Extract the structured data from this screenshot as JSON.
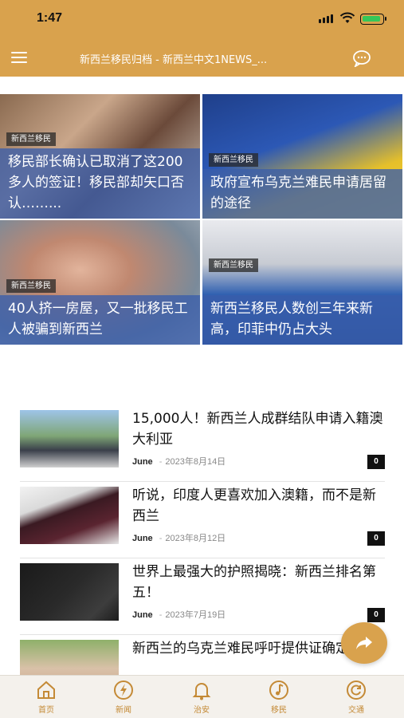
{
  "status_bar": {
    "time": "1:47"
  },
  "header": {
    "title": "新西兰移民归档 - 新西兰中文1NEWS_..."
  },
  "featured": [
    {
      "tag": "新西兰移民",
      "caption": "移民部长确认已取消了这200多人的签证！移民部却矢口否认……..."
    },
    {
      "tag": "新西兰移民",
      "caption": "政府宣布乌克兰难民申请居留的途径"
    },
    {
      "tag": "新西兰移民",
      "caption": "40人挤一房屋，又一批移民工人被骗到新西兰"
    },
    {
      "tag": "新西兰移民",
      "caption": "新西兰移民人数创三年来新高，印菲中仍占大头"
    }
  ],
  "articles": [
    {
      "title": "15,000人！新西兰人成群结队申请入籍澳大利亚",
      "author": "June",
      "date": "2023年8月14日",
      "comments": "0"
    },
    {
      "title": "听说，印度人更喜欢加入澳籍，而不是新西兰",
      "author": "June",
      "date": "2023年8月12日",
      "comments": "0"
    },
    {
      "title": "世界上最强大的护照揭晓：新西兰排名第五！",
      "author": "June",
      "date": "2023年7月19日",
      "comments": "0"
    },
    {
      "title": "新西兰的乌克兰难民呼吁提供证确定性",
      "author": "",
      "date": "",
      "comments": ""
    }
  ],
  "tabs": [
    {
      "label": "首页",
      "icon": "home-icon"
    },
    {
      "label": "新闻",
      "icon": "lightning-icon"
    },
    {
      "label": "治安",
      "icon": "bell-icon"
    },
    {
      "label": "移民",
      "icon": "music-note-icon"
    },
    {
      "label": "交通",
      "icon": "refresh-icon"
    }
  ],
  "colors": {
    "brand": "#d9a24d",
    "caption_overlay": "#3a5eaa",
    "tab_label": "#c48a36"
  }
}
